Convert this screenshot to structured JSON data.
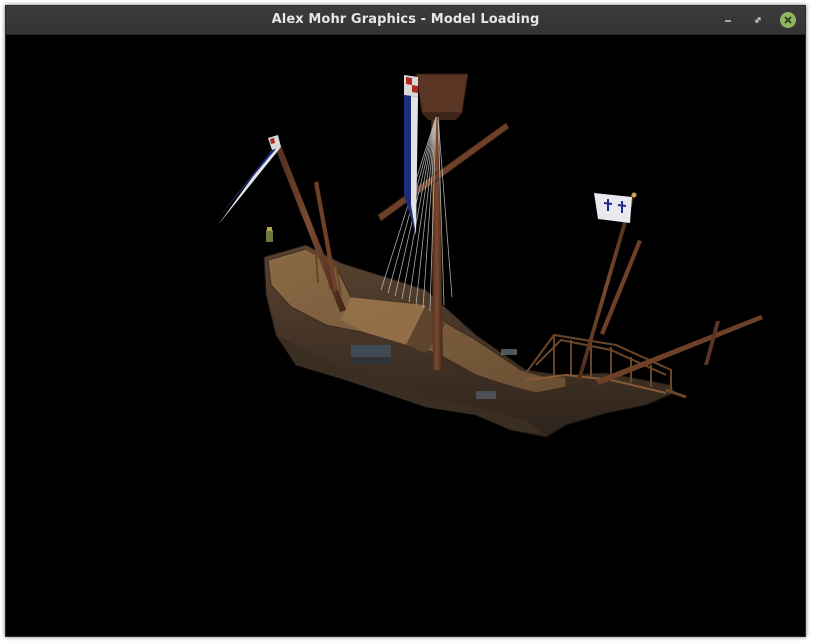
{
  "window": {
    "title": "Alex Mohr Graphics - Model Loading",
    "controls": {
      "minimize_icon": "minimize-icon",
      "maximize_icon": "maximize-icon",
      "close_icon": "close-icon",
      "close_color": "#8fb55e"
    }
  },
  "viewport": {
    "background": "#000000",
    "scene_object": "3d-ship-model"
  }
}
